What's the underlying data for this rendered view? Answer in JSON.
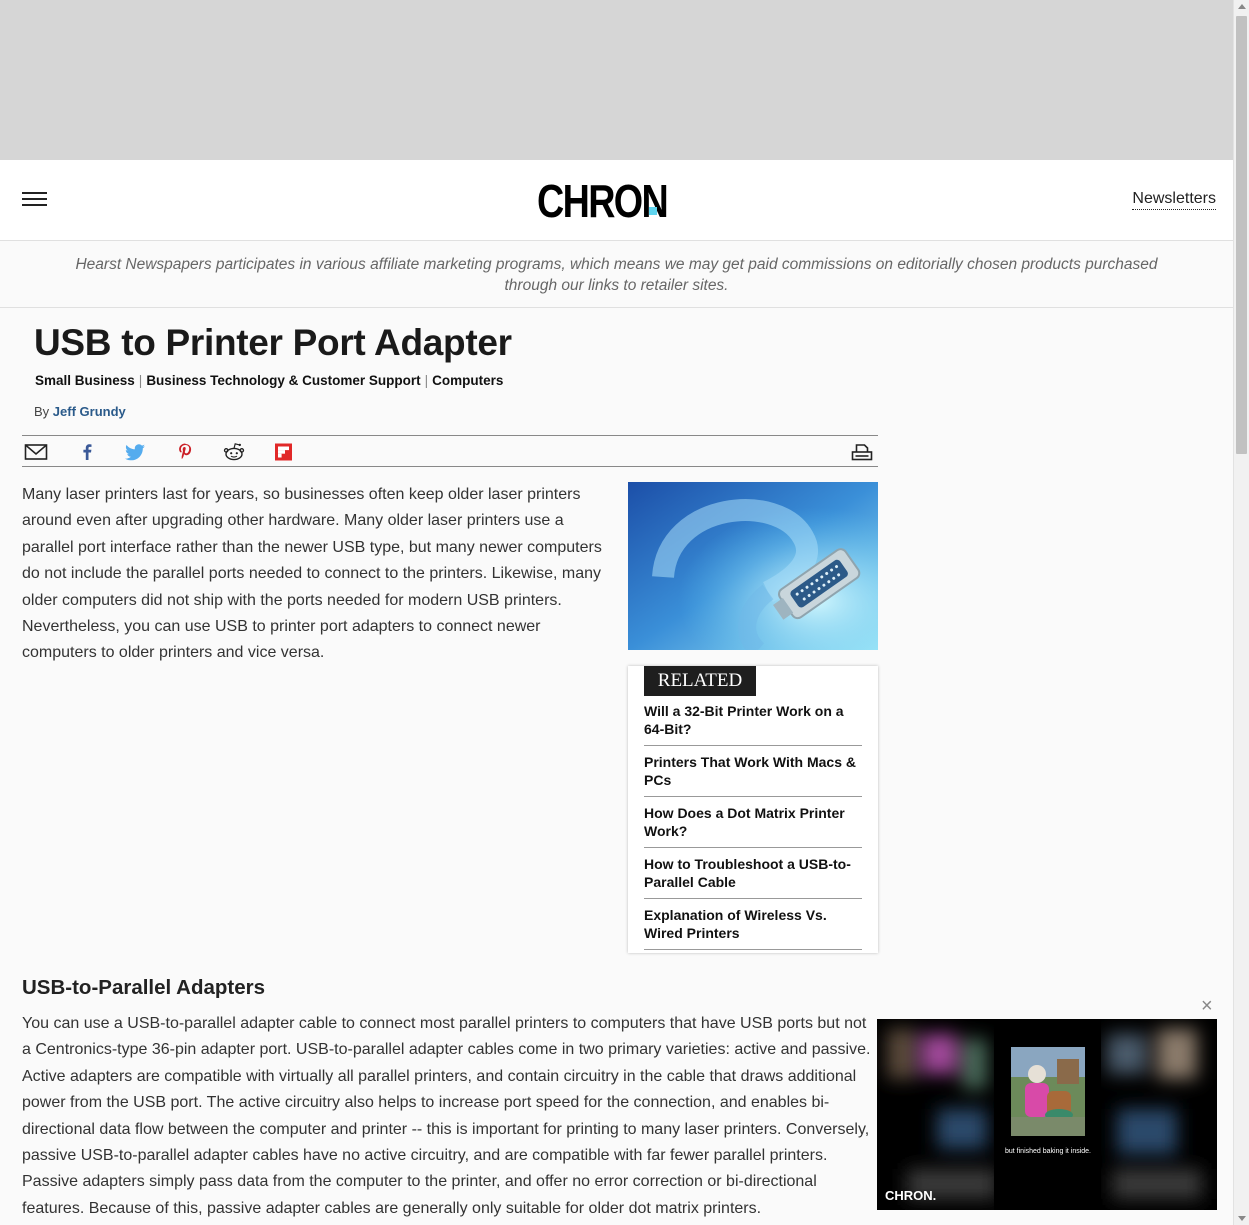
{
  "header": {
    "logo": "CHRON",
    "newsletters_label": "Newsletters"
  },
  "disclaimer": "Hearst Newspapers participates in various affiliate marketing programs, which means we may get paid commissions on editorially chosen products purchased through our links to retailer sites.",
  "article": {
    "title": "USB to Printer Port Adapter",
    "categories": [
      "Small Business",
      "Business Technology & Customer Support",
      "Computers"
    ],
    "byline_prefix": "By",
    "author": "Jeff Grundy",
    "intro": "Many laser printers last for years, so businesses often keep older laser printers around even after upgrading other hardware. Many older laser printers use a parallel port interface rather than the newer USB type, but many newer computers do not include the parallel ports needed to connect to the printers. Likewise, many older computers did not ship with the ports needed for modern USB printers. Nevertheless, you can use USB to printer port adapters to connect newer computers to older printers and vice versa.",
    "section_heading": "USB-to-Parallel Adapters",
    "section_text": "You can use a USB-to-parallel adapter cable to connect most parallel printers to computers that have USB ports but not a Centronics-type 36-pin adapter port. USB-to-parallel adapter cables come in two primary varieties: active and passive. Active adapters are compatible with virtually all parallel printers, and contain circuitry in the cable that draws additional power from the USB port. The active circuitry also helps to increase port speed for the connection, and enables bi-directional data flow between the computer and printer -- this is important for printing to many laser printers. Conversely, passive USB-to-parallel adapter cables have no active circuitry, and are compatible with far fewer parallel printers. Passive adapters simply pass data from the computer to the printer, and offer no error correction or bi-directional features. Because of this, passive adapter cables are generally only suitable for older dot matrix printers."
  },
  "share_icons": [
    "email-icon",
    "facebook-icon",
    "twitter-icon",
    "pinterest-icon",
    "reddit-icon",
    "flipboard-icon",
    "print-icon"
  ],
  "related": {
    "tag": "RELATED",
    "items": [
      "Will a 32-Bit Printer Work on a 64-Bit?",
      "Printers That Work With Macs & PCs",
      "How Does a Dot Matrix Printer Work?",
      "How to Troubleshoot a USB-to-Parallel Cable",
      "Explanation of Wireless Vs. Wired Printers"
    ]
  },
  "video": {
    "caption": "but finished baking it inside.",
    "watermark": "CHRON.",
    "close_glyph": "×"
  },
  "colors": {
    "logo_dot": "#5fd4ee",
    "author_link": "#2a5a8a",
    "facebook": "#3b5998",
    "twitter": "#55acee",
    "pinterest": "#cb2027",
    "flipboard": "#e12828"
  }
}
